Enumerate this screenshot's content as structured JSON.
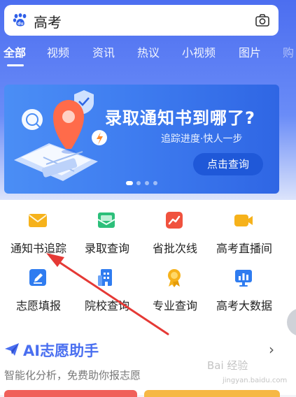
{
  "search": {
    "query": "高考",
    "logo_icon": "baidu-paw-icon",
    "camera_icon": "camera-icon"
  },
  "tabs": [
    {
      "label": "全部",
      "active": true
    },
    {
      "label": "视频"
    },
    {
      "label": "资讯"
    },
    {
      "label": "热议"
    },
    {
      "label": "小视频"
    },
    {
      "label": "图片"
    },
    {
      "label": "购"
    }
  ],
  "banner": {
    "title": "录取通知书到哪了?",
    "subtitle": "追踪进度·快人一步",
    "cta": "点击查询"
  },
  "services": [
    {
      "label": "通知书追踪",
      "icon": "envelope-icon",
      "color": "#f6b21b"
    },
    {
      "label": "录取查询",
      "icon": "mail-check-icon",
      "color": "#2cbf7a"
    },
    {
      "label": "省批次线",
      "icon": "trend-chart-icon",
      "color": "#f0523e"
    },
    {
      "label": "高考直播间",
      "icon": "video-camera-icon",
      "color": "#f6b21b"
    },
    {
      "label": "志愿填报",
      "icon": "pen-icon",
      "color": "#2f7cf0"
    },
    {
      "label": "院校查询",
      "icon": "building-icon",
      "color": "#2f7cf0"
    },
    {
      "label": "专业查询",
      "icon": "medal-icon",
      "color": "#f6b21b"
    },
    {
      "label": "高考大数据",
      "icon": "data-screen-icon",
      "color": "#2f7cf0"
    }
  ],
  "ai": {
    "title": "AI志愿助手",
    "subtitle": "智能化分析，免费助你报志愿",
    "icon": "paper-plane-icon"
  },
  "watermark": {
    "line1": "Bai 经验",
    "line2": "jingyan.baidu.com"
  },
  "colors": {
    "brand": "#4c6ef0",
    "banner_button": "#1f58d8",
    "annotation_arrow": "#e53935"
  }
}
